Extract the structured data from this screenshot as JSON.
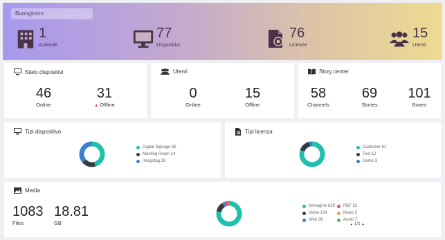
{
  "banner": {
    "greeting": "Buongiorno",
    "kpis": [
      {
        "value": "1",
        "label": "Aziende",
        "icon": "building-icon"
      },
      {
        "value": "77",
        "label": "Dispositivi",
        "icon": "monitor-icon"
      },
      {
        "value": "76",
        "label": "Licenze",
        "icon": "license-icon"
      },
      {
        "value": "15",
        "label": "Utenti",
        "icon": "users-icon"
      }
    ]
  },
  "stato": {
    "title": "Stato dispositivi",
    "online_value": "46",
    "online_label": "Online",
    "offline_value": "31",
    "offline_label": "Offline"
  },
  "utenti": {
    "title": "Utenti",
    "online_value": "0",
    "online_label": "Online",
    "offline_value": "15",
    "offline_label": "Offline"
  },
  "story": {
    "title": "Story center",
    "channels_value": "58",
    "channels_label": "Channels",
    "stories_value": "69",
    "stories_label": "Stories",
    "boxes_value": "101",
    "boxes_label": "Boxes"
  },
  "tipi_dispositivo": {
    "title": "Tipi dispositivo",
    "items": [
      {
        "label": "Digital Signage 35",
        "value": 35,
        "color": "#1ec0ad"
      },
      {
        "label": "Meeting Room 14",
        "value": 14,
        "color": "#333a44"
      },
      {
        "label": "Imagotag 28",
        "value": 28,
        "color": "#3c7fcf"
      }
    ]
  },
  "tipi_licenza": {
    "title": "Tipi licenza",
    "items": [
      {
        "label": "Customer 61",
        "value": 61,
        "color": "#1ec0ad"
      },
      {
        "label": "Test 12",
        "value": 12,
        "color": "#333a44"
      },
      {
        "label": "Demo 3",
        "value": 3,
        "color": "#3c7fcf"
      }
    ]
  },
  "media": {
    "title": "Media",
    "files_value": "1083",
    "files_label": "Files",
    "gb_value": "18.81",
    "gb_label": "GB",
    "items": [
      {
        "label": "Immagine 829",
        "value": 829,
        "color": "#1ec0ad"
      },
      {
        "label": "Video 134",
        "value": 134,
        "color": "#333a44"
      },
      {
        "label": "Web 36",
        "value": 36,
        "color": "#3c7fcf"
      },
      {
        "label": "PDF 52",
        "value": 52,
        "color": "#e24a8f"
      },
      {
        "label": "News 5",
        "value": 5,
        "color": "#f0a040"
      },
      {
        "label": "Audio 7",
        "value": 7,
        "color": "#5cb85c"
      }
    ],
    "pager": "1/2",
    "prev": "◂",
    "next": "▸"
  }
}
